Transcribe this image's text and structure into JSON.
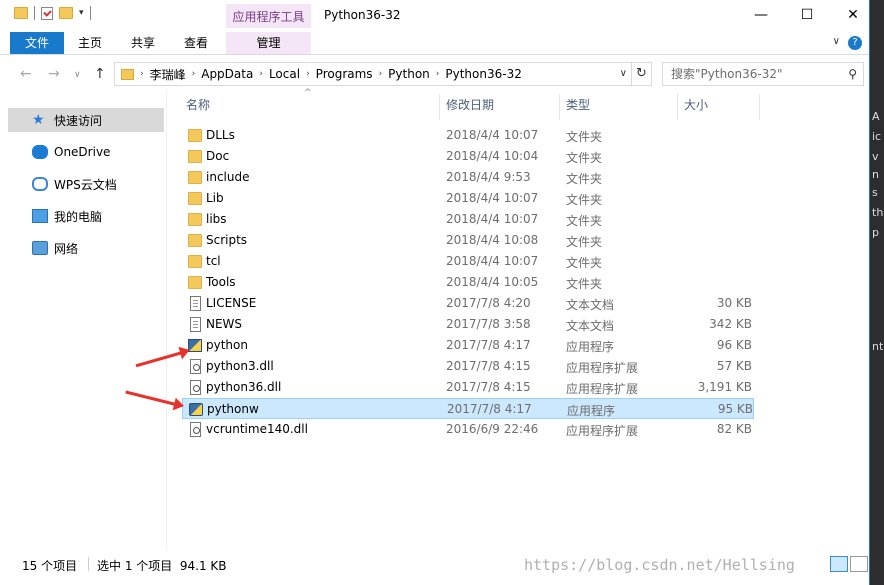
{
  "window": {
    "title": "Python36-32",
    "context_tab_group": "应用程序工具",
    "controls": {
      "minimize": "—",
      "maximize": "☐",
      "close": "✕"
    }
  },
  "ribbon": {
    "tabs": [
      "文件",
      "主页",
      "共享",
      "查看",
      "管理"
    ],
    "file_color": "#1979ca",
    "manage_color": "#f4e6f7",
    "help": "?"
  },
  "address": {
    "crumbs": [
      "李瑞峰",
      "AppData",
      "Local",
      "Programs",
      "Python",
      "Python36-32"
    ],
    "search_placeholder": "搜索\"Python36-32\""
  },
  "sidebar": {
    "items": [
      {
        "label": "快速访问",
        "icon": "star-icon",
        "selected": true
      },
      {
        "label": "OneDrive",
        "icon": "cloud-icon",
        "selected": false
      },
      {
        "label": "WPS云文档",
        "icon": "wps-cloud-icon",
        "selected": false
      },
      {
        "label": "我的电脑",
        "icon": "computer-icon",
        "selected": false
      },
      {
        "label": "网络",
        "icon": "network-icon",
        "selected": false
      }
    ]
  },
  "columns": [
    "名称",
    "修改日期",
    "类型",
    "大小"
  ],
  "files": [
    {
      "name": "DLLs",
      "date": "2018/4/4 10:07",
      "type": "文件夹",
      "size": "",
      "icon": "folder-icon"
    },
    {
      "name": "Doc",
      "date": "2018/4/4 10:04",
      "type": "文件夹",
      "size": "",
      "icon": "folder-icon"
    },
    {
      "name": "include",
      "date": "2018/4/4 9:53",
      "type": "文件夹",
      "size": "",
      "icon": "folder-icon"
    },
    {
      "name": "Lib",
      "date": "2018/4/4 10:07",
      "type": "文件夹",
      "size": "",
      "icon": "folder-icon"
    },
    {
      "name": "libs",
      "date": "2018/4/4 10:07",
      "type": "文件夹",
      "size": "",
      "icon": "folder-icon"
    },
    {
      "name": "Scripts",
      "date": "2018/4/4 10:08",
      "type": "文件夹",
      "size": "",
      "icon": "folder-icon"
    },
    {
      "name": "tcl",
      "date": "2018/4/4 10:07",
      "type": "文件夹",
      "size": "",
      "icon": "folder-icon"
    },
    {
      "name": "Tools",
      "date": "2018/4/4 10:05",
      "type": "文件夹",
      "size": "",
      "icon": "folder-icon"
    },
    {
      "name": "LICENSE",
      "date": "2017/7/8 4:20",
      "type": "文本文档",
      "size": "30 KB",
      "icon": "text-file-icon"
    },
    {
      "name": "NEWS",
      "date": "2017/7/8 3:58",
      "type": "文本文档",
      "size": "342 KB",
      "icon": "text-file-icon"
    },
    {
      "name": "python",
      "date": "2017/7/8 4:17",
      "type": "应用程序",
      "size": "96 KB",
      "icon": "python-exe-icon"
    },
    {
      "name": "python3.dll",
      "date": "2017/7/8 4:15",
      "type": "应用程序扩展",
      "size": "57 KB",
      "icon": "dll-file-icon"
    },
    {
      "name": "python36.dll",
      "date": "2017/7/8 4:15",
      "type": "应用程序扩展",
      "size": "3,191 KB",
      "icon": "dll-file-icon"
    },
    {
      "name": "pythonw",
      "date": "2017/7/8 4:17",
      "type": "应用程序",
      "size": "95 KB",
      "icon": "pythonw-exe-icon",
      "selected": true
    },
    {
      "name": "vcruntime140.dll",
      "date": "2016/6/9 22:46",
      "type": "应用程序扩展",
      "size": "82 KB",
      "icon": "dll-file-icon"
    }
  ],
  "status": {
    "item_count": "15 个项目",
    "selection": "选中 1 个项目  94.1 KB"
  },
  "watermark": "https://blog.csdn.net/Hellsing",
  "annotation_color": "#e8312a",
  "right_strip": [
    "A",
    "ic",
    "v",
    "n",
    "s",
    "th",
    "p",
    "nt"
  ]
}
